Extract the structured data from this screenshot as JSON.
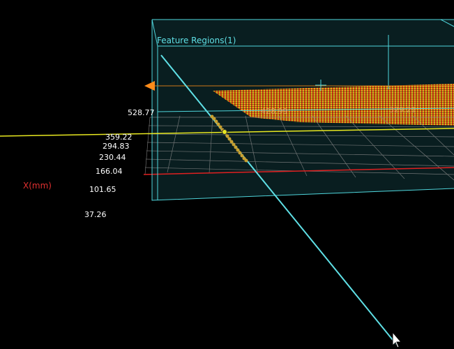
{
  "viewer": {
    "region_title": "Feature Regions(1)",
    "axis_title": "X(mm)",
    "tick_labels": [
      "528.77",
      "359.22",
      "294.83",
      "230.44",
      "166.04",
      "101.65",
      "37.26"
    ],
    "inner_labels": [
      "428.99",
      "329.21"
    ]
  },
  "colors": {
    "background": "#000000",
    "region_box": "#4fd6dc",
    "region_fill": "#0b2326",
    "axis_title": "#e03030",
    "inner_label": "#e3a060",
    "highlight_line": "#e8e820",
    "laser_line": "#5fe0e6",
    "marker": "#ff8c1a",
    "feature_points": "#c8a030"
  },
  "icons": {
    "cursor": "mouse-cursor-icon",
    "orientation_marker": "triangle-marker-icon",
    "crosshair": "crosshair-icon"
  }
}
